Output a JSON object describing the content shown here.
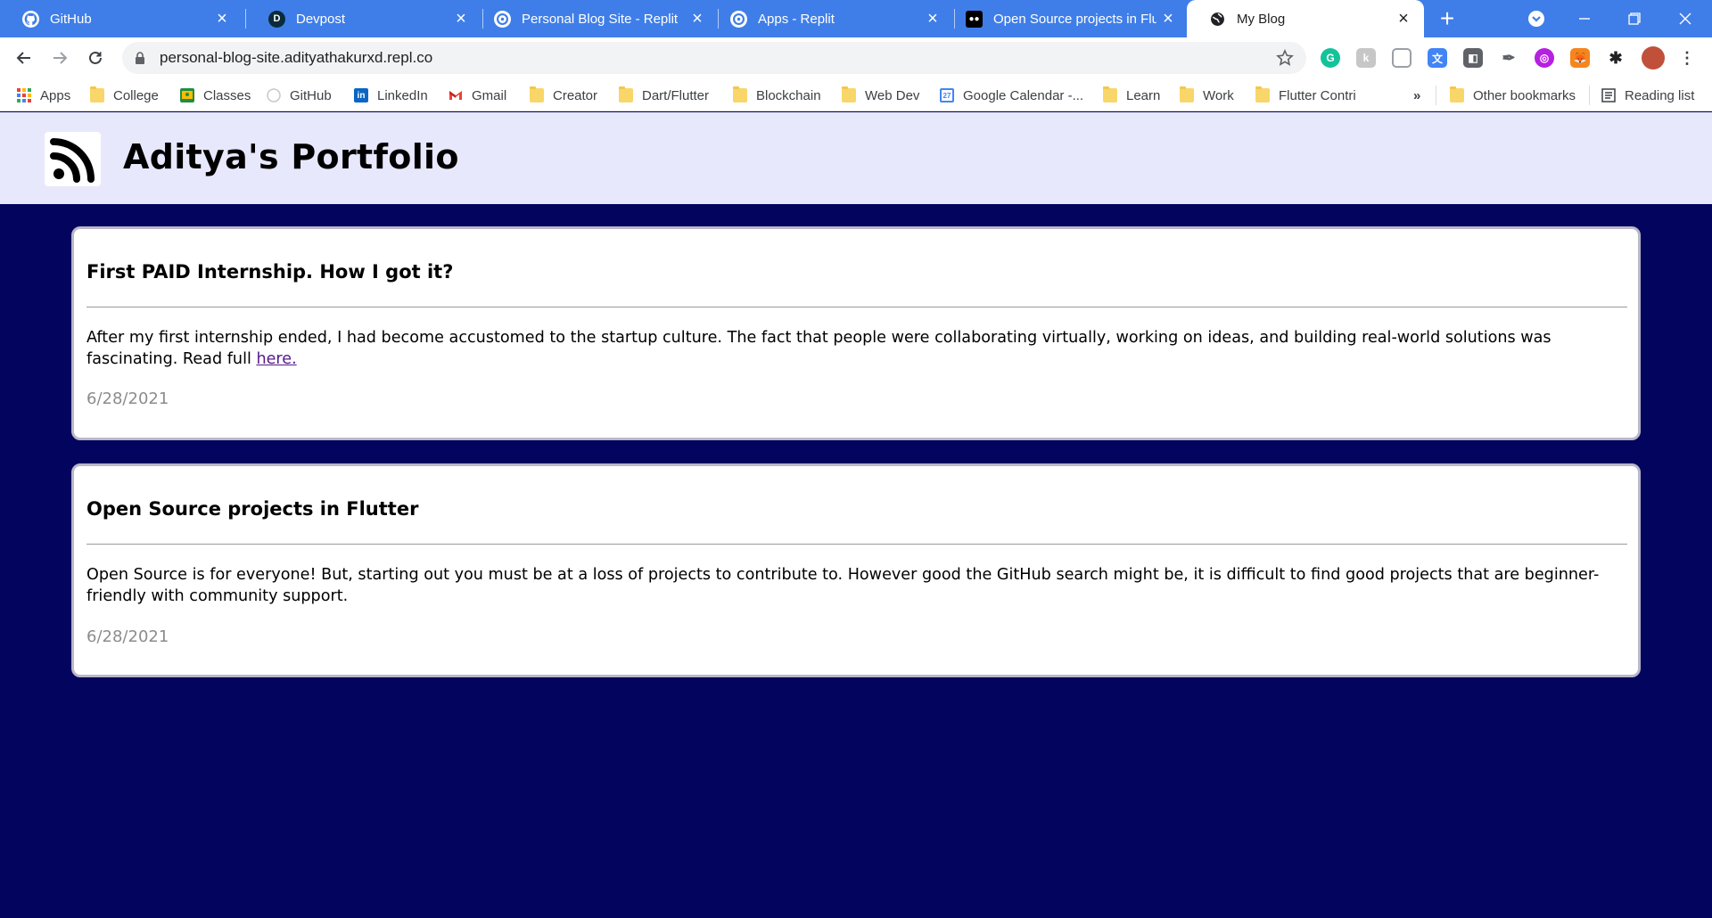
{
  "browser": {
    "tabs": [
      {
        "title": "GitHub",
        "icon": "github-icon"
      },
      {
        "title": "Devpost",
        "icon": "devpost-icon"
      },
      {
        "title": "Personal Blog Site - Replit",
        "icon": "replit-icon"
      },
      {
        "title": "Apps - Replit",
        "icon": "replit-icon"
      },
      {
        "title": "Open Source projects in Flu",
        "icon": "medium-icon"
      },
      {
        "title": "My Blog",
        "icon": "globe-icon",
        "active": true
      }
    ],
    "tab_close": "×",
    "new_tab": "+",
    "url": "personal-blog-site.adityathakurxd.repl.co",
    "bookmarks": [
      {
        "label": "Apps",
        "icon": "apps-grid-icon"
      },
      {
        "label": "College",
        "icon": "folder-icon"
      },
      {
        "label": "Classes",
        "icon": "classroom-icon"
      },
      {
        "label": "GitHub",
        "icon": "github-icon"
      },
      {
        "label": "LinkedIn",
        "icon": "linkedin-icon"
      },
      {
        "label": "Gmail",
        "icon": "gmail-icon"
      },
      {
        "label": "Creator",
        "icon": "folder-icon"
      },
      {
        "label": "Dart/Flutter",
        "icon": "folder-icon"
      },
      {
        "label": "Blockchain",
        "icon": "folder-icon"
      },
      {
        "label": "Web Dev",
        "icon": "folder-icon"
      },
      {
        "label": "Google Calendar -...",
        "icon": "calendar-icon"
      },
      {
        "label": "Learn",
        "icon": "folder-icon"
      },
      {
        "label": "Work",
        "icon": "folder-icon"
      },
      {
        "label": "Flutter Contri",
        "icon": "folder-icon"
      }
    ],
    "more_bookmarks": "»",
    "other_bookmarks": "Other bookmarks",
    "reading_list": "Reading list"
  },
  "site": {
    "title": "Aditya's Portfolio",
    "logo_icon": "rss-feed-icon",
    "background": "#03045e",
    "header_background": "#e8e8fd"
  },
  "posts": [
    {
      "title": "First PAID Internship. How I got it?",
      "body": "After my first internship ended, I had become accustomed to the startup culture. The fact that people were collaborating virtually, working on ideas, and building real-world solutions was fascinating. Read full ",
      "link_text": "here.",
      "date": "6/28/2021"
    },
    {
      "title": "Open Source projects in Flutter",
      "body": "Open Source is for everyone! But, starting out you must be at a loss of projects to contribute to. However good the GitHub search might be, it is difficult to find good projects that are beginner-friendly with community support.",
      "date": "6/28/2021"
    }
  ]
}
